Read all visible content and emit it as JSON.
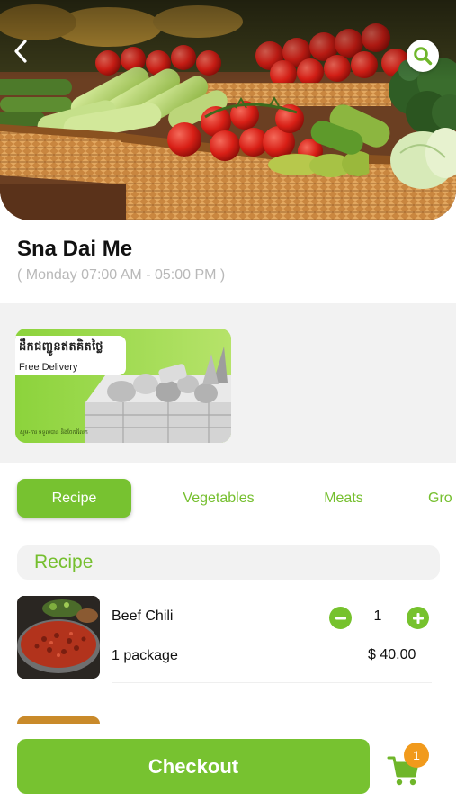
{
  "store": {
    "name": "Sna Dai Me",
    "hours": "( Monday 07:00 AM - 05:00 PM )"
  },
  "promo": {
    "title_kh": "ដឹកជញ្ជូនឥតគិតថ្លៃ",
    "subtitle": "Free Delivery",
    "footer": "សូម-ការ ទទួលបាន និងចែករំលែក"
  },
  "tabs": [
    {
      "label": "Recipe",
      "active": true
    },
    {
      "label": "Vegetables",
      "active": false
    },
    {
      "label": "Meats",
      "active": false
    },
    {
      "label": "Gro",
      "active": false
    }
  ],
  "section": {
    "title": "Recipe"
  },
  "products": [
    {
      "name": "Beef Chili",
      "unit": "1 package",
      "quantity": "1",
      "price": "$ 40.00"
    }
  ],
  "checkout": {
    "label": "Checkout"
  },
  "cart": {
    "count": "1"
  },
  "icons": {
    "back": "chevron-left-icon",
    "search": "search-icon",
    "decrease": "minus-icon",
    "increase": "plus-icon",
    "cart": "shopping-cart-icon"
  },
  "colors": {
    "accent": "#77c230",
    "badge": "#f19a1c",
    "muted_text": "#b8b8b8",
    "background_band": "#f2f2f2"
  }
}
